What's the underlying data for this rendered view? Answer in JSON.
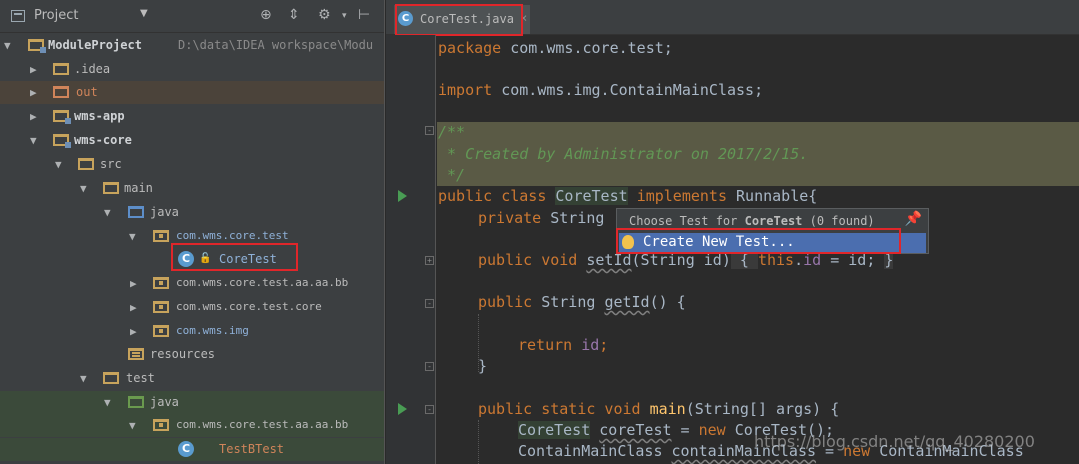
{
  "project_panel": {
    "title": "Project",
    "header_icons": [
      "target-icon",
      "collapse-icon",
      "gear-icon",
      "hide-icon"
    ],
    "tree": [
      {
        "label": "ModuleProject",
        "path": "D:\\data\\IDEA workspace\\Modu",
        "kind": "module",
        "expanded": true
      },
      {
        "label": ".idea",
        "kind": "folder",
        "expanded": false
      },
      {
        "label": "out",
        "kind": "excluded-folder",
        "expanded": false
      },
      {
        "label": "wms-app",
        "kind": "module",
        "expanded": false
      },
      {
        "label": "wms-core",
        "kind": "module",
        "expanded": true
      },
      {
        "label": "src",
        "kind": "folder",
        "expanded": true
      },
      {
        "label": "main",
        "kind": "folder",
        "expanded": true
      },
      {
        "label": "java",
        "kind": "source-root",
        "expanded": true
      },
      {
        "label": "com.wms.core.test",
        "kind": "package",
        "expanded": true
      },
      {
        "label": "CoreTest",
        "kind": "class"
      },
      {
        "label": "com.wms.core.test.aa.aa.bb",
        "kind": "package",
        "expanded": false
      },
      {
        "label": "com.wms.core.test.core",
        "kind": "package",
        "expanded": false
      },
      {
        "label": "com.wms.img",
        "kind": "package",
        "expanded": false
      },
      {
        "label": "resources",
        "kind": "resources-root"
      },
      {
        "label": "test",
        "kind": "folder",
        "expanded": true
      },
      {
        "label": "java",
        "kind": "test-root",
        "expanded": true
      },
      {
        "label": "com.wms.core.test.aa.aa.bb",
        "kind": "package",
        "expanded": true
      },
      {
        "label": "TestBTest",
        "kind": "test-class"
      }
    ]
  },
  "editor": {
    "tab_label": "CoreTest.java",
    "tab_close": "×",
    "code": {
      "l1_kw": "package",
      "l1_rest": " com.wms.core.test;",
      "l2_kw": "import",
      "l2_rest": " com.wms.img.ContainMainClass;",
      "c1": "/**",
      "c2": " * Created by Administrator on 2017/2/15.",
      "c3": " */",
      "l4_kw": "public class",
      "l4_cls": "CoreTest",
      "l4_kw2": "implements",
      "l4_rest": "Runnable{",
      "l5_kw": "private",
      "l5_rest": " String",
      "l6_kw": "public void",
      "l6_m": "setId",
      "l6_args": "(String id)",
      "l6_b1": " { ",
      "l6_this": "this",
      "l6_dot": ".",
      "l6_fld": "id",
      "l6_eq": " = id; ",
      "l6_b2": "}",
      "l7_kw": "public",
      "l7_type": " String ",
      "l7_m": "getId",
      "l7_rest": "() {",
      "l8_kw": "return",
      "l8_fld": "id",
      "l8_semi": ";",
      "l9": "}",
      "l10_kw": "public static void",
      "l10_m": "main",
      "l10_rest": "(String[] args) {",
      "l11_type": "CoreTest",
      "l11_var": "coreTest",
      "l11_eq": " = ",
      "l11_new": "new",
      "l11_rest": " CoreTest();",
      "l12_type": "ContainMainClass",
      "l12_var": "containMainClass",
      "l12_eq": " = ",
      "l12_new": "new",
      "l12_rest": " ContainMainClass"
    }
  },
  "popup": {
    "title_prefix": "Choose Test for ",
    "title_class": "CoreTest",
    "title_suffix": " (0 found)",
    "item_label": "Create New Test...",
    "pin_icon": "pin-icon"
  },
  "watermark": "https://blog.csdn.net/qq_40280200",
  "colors": {
    "keyword": "#cc7832",
    "comment": "#629755",
    "field": "#9876aa",
    "method": "#ffc66d",
    "highlight_box": "#e0262a",
    "popup_selection": "#4b6eaf"
  }
}
